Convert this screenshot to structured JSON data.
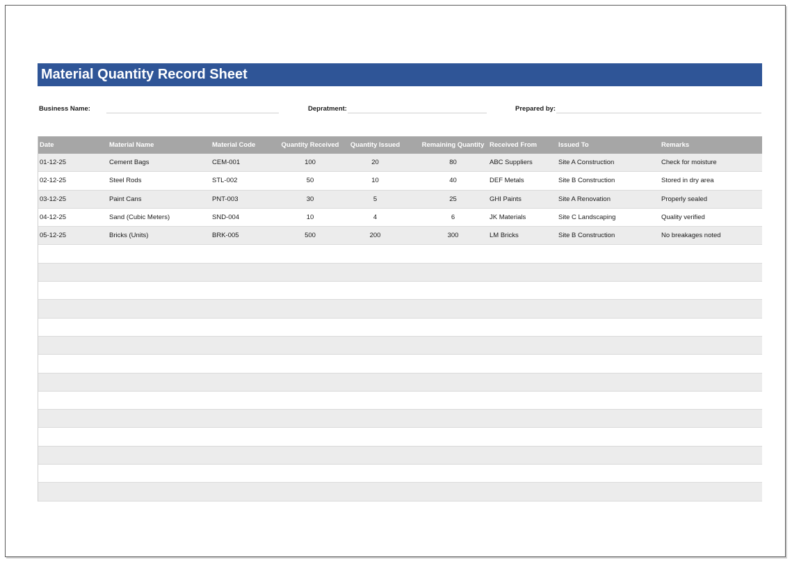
{
  "title": "Material Quantity Record Sheet",
  "fields": {
    "business_name_label": "Business Name:",
    "department_label": "Depratment:",
    "prepared_by_label": "Prepared by:"
  },
  "table": {
    "headers": [
      "Date",
      "Material Name",
      "Material Code",
      "Quantity Received",
      "Quantity Issued",
      "Remaining Quantity",
      "Received From",
      "Issued To",
      "Remarks"
    ],
    "rows": [
      [
        "01-12-25",
        "Cement Bags",
        "CEM-001",
        "100",
        "20",
        "80",
        "ABC Suppliers",
        "Site A Construction",
        "Check for moisture"
      ],
      [
        "02-12-25",
        "Steel Rods",
        "STL-002",
        "50",
        "10",
        "40",
        "DEF Metals",
        "Site B Construction",
        "Stored in dry area"
      ],
      [
        "03-12-25",
        "Paint Cans",
        "PNT-003",
        "30",
        "5",
        "25",
        "GHI Paints",
        "Site A Renovation",
        "Properly sealed"
      ],
      [
        "04-12-25",
        "Sand (Cubic Meters)",
        "SND-004",
        "10",
        "4",
        "6",
        "JK Materials",
        "Site C Landscaping",
        "Quality verified"
      ],
      [
        "05-12-25",
        "Bricks (Units)",
        "BRK-005",
        "500",
        "200",
        "300",
        "LM Bricks",
        "Site B Construction",
        "No breakages noted"
      ]
    ],
    "empty_row_count": 14
  },
  "colors": {
    "title_bar": "#2f5597",
    "header_row": "#a6a6a6",
    "stripe": "#ececec"
  }
}
